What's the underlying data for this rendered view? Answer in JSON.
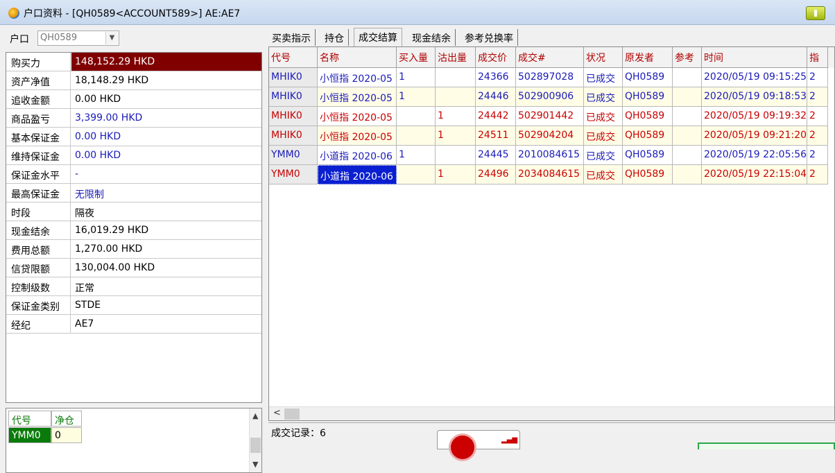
{
  "window": {
    "title": "户口资料 - [QH0589<ACCOUNT589>] AE:AE7"
  },
  "account": {
    "label": "户口",
    "value": "QH0589"
  },
  "info_rows": [
    {
      "key": "购买力",
      "value": "148,152.29 HKD",
      "style": "highlight"
    },
    {
      "key": "资产净值",
      "value": "18,148.29 HKD",
      "style": ""
    },
    {
      "key": "追收金额",
      "value": "0.00 HKD",
      "style": ""
    },
    {
      "key": "商品盈亏",
      "value": "3,399.00 HKD",
      "style": "blue"
    },
    {
      "key": "基本保证金",
      "value": "0.00 HKD",
      "style": "blue"
    },
    {
      "key": "维持保证金",
      "value": "0.00 HKD",
      "style": "blue"
    },
    {
      "key": "保证金水平",
      "value": "-",
      "style": "blue"
    },
    {
      "key": "最高保证金",
      "value": "无限制",
      "style": "blue"
    },
    {
      "key": "时段",
      "value": "隔夜",
      "style": ""
    },
    {
      "key": "现金结余",
      "value": "16,019.29 HKD",
      "style": ""
    },
    {
      "key": "费用总额",
      "value": "1,270.00 HKD",
      "style": ""
    },
    {
      "key": "信贷限额",
      "value": "130,004.00 HKD",
      "style": ""
    },
    {
      "key": "控制级数",
      "value": "正常",
      "style": ""
    },
    {
      "key": "保证金类别",
      "value": "STDE",
      "style": ""
    },
    {
      "key": "经纪",
      "value": "AE7",
      "style": ""
    }
  ],
  "positions": {
    "headers": [
      "代号",
      "净仓"
    ],
    "rows": [
      [
        "YMM0",
        "0"
      ]
    ]
  },
  "tabs": [
    "买卖指示",
    "持仓",
    "成交结算",
    "现金结余",
    "参考兑换率"
  ],
  "active_tab": 2,
  "trades": {
    "headers": [
      "代号",
      "名称",
      "买入量",
      "沽出量",
      "成交价",
      "成交#",
      "状况",
      "原发者",
      "参考",
      "时间",
      "指"
    ],
    "rows": [
      {
        "side": "buy",
        "cells": [
          "MHIK0",
          "小恒指 2020-05",
          "1",
          "",
          "24366",
          "502897028",
          "已成交",
          "QH0589",
          "",
          "2020/05/19 09:15:25",
          "2"
        ]
      },
      {
        "side": "buy",
        "cells": [
          "MHIK0",
          "小恒指 2020-05",
          "1",
          "",
          "24446",
          "502900906",
          "已成交",
          "QH0589",
          "",
          "2020/05/19 09:18:53",
          "2"
        ]
      },
      {
        "side": "sell",
        "cells": [
          "MHIK0",
          "小恒指 2020-05",
          "",
          "1",
          "24442",
          "502901442",
          "已成交",
          "QH0589",
          "",
          "2020/05/19 09:19:32",
          "2"
        ]
      },
      {
        "side": "sell",
        "cells": [
          "MHIK0",
          "小恒指 2020-05",
          "",
          "1",
          "24511",
          "502904204",
          "已成交",
          "QH0589",
          "",
          "2020/05/19 09:21:20",
          "2"
        ]
      },
      {
        "side": "buy",
        "cells": [
          "YMM0",
          "小道指 2020-06",
          "1",
          "",
          "24445",
          "2010084615",
          "已成交",
          "QH0589",
          "",
          "2020/05/19 22:05:56",
          "2"
        ]
      },
      {
        "side": "sell",
        "cells": [
          "YMM0",
          "小道指 2020-06",
          "",
          "1",
          "24496",
          "2034084615",
          "已成交",
          "QH0589",
          "",
          "2020/05/19 22:15:04",
          "2"
        ]
      }
    ]
  },
  "status": {
    "label": "成交记录：6"
  },
  "colors": {
    "highlight_bg": "#800000",
    "buy": "#1a1ab8",
    "sell": "#c80000",
    "selection": "#0a1fd0"
  }
}
